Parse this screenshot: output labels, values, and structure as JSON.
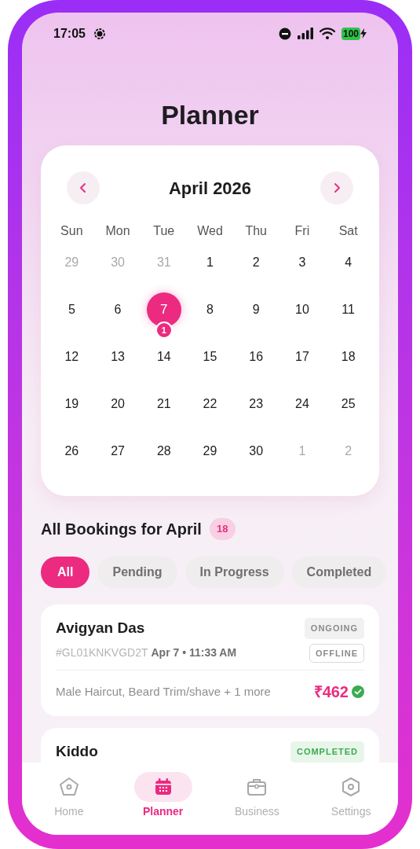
{
  "status_bar": {
    "time": "17:05",
    "battery": "100"
  },
  "title": "Planner",
  "calendar": {
    "month": "April 2026",
    "weekdays": [
      "Sun",
      "Mon",
      "Tue",
      "Wed",
      "Thu",
      "Fri",
      "Sat"
    ],
    "weeks": [
      [
        {
          "day": "29",
          "muted": true,
          "selected": false
        },
        {
          "day": "30",
          "muted": true,
          "selected": false
        },
        {
          "day": "31",
          "muted": true,
          "selected": false
        },
        {
          "day": "1",
          "muted": false,
          "selected": false
        },
        {
          "day": "2",
          "muted": false,
          "selected": false
        },
        {
          "day": "3",
          "muted": false,
          "selected": false
        },
        {
          "day": "4",
          "muted": false,
          "selected": false
        }
      ],
      [
        {
          "day": "5",
          "muted": false,
          "selected": false
        },
        {
          "day": "6",
          "muted": false,
          "selected": false
        },
        {
          "day": "7",
          "muted": false,
          "selected": true,
          "count": "1"
        },
        {
          "day": "8",
          "muted": false,
          "selected": false
        },
        {
          "day": "9",
          "muted": false,
          "selected": false
        },
        {
          "day": "10",
          "muted": false,
          "selected": false
        },
        {
          "day": "11",
          "muted": false,
          "selected": false
        }
      ],
      [
        {
          "day": "12",
          "muted": false,
          "selected": false
        },
        {
          "day": "13",
          "muted": false,
          "selected": false
        },
        {
          "day": "14",
          "muted": false,
          "selected": false
        },
        {
          "day": "15",
          "muted": false,
          "selected": false
        },
        {
          "day": "16",
          "muted": false,
          "selected": false
        },
        {
          "day": "17",
          "muted": false,
          "selected": false
        },
        {
          "day": "18",
          "muted": false,
          "selected": false
        }
      ],
      [
        {
          "day": "19",
          "muted": false,
          "selected": false
        },
        {
          "day": "20",
          "muted": false,
          "selected": false
        },
        {
          "day": "21",
          "muted": false,
          "selected": false
        },
        {
          "day": "22",
          "muted": false,
          "selected": false
        },
        {
          "day": "23",
          "muted": false,
          "selected": false
        },
        {
          "day": "24",
          "muted": false,
          "selected": false
        },
        {
          "day": "25",
          "muted": false,
          "selected": false
        }
      ],
      [
        {
          "day": "26",
          "muted": false,
          "selected": false
        },
        {
          "day": "27",
          "muted": false,
          "selected": false
        },
        {
          "day": "28",
          "muted": false,
          "selected": false
        },
        {
          "day": "29",
          "muted": false,
          "selected": false
        },
        {
          "day": "30",
          "muted": false,
          "selected": false
        },
        {
          "day": "1",
          "muted": true,
          "selected": false
        },
        {
          "day": "2",
          "muted": true,
          "selected": false
        }
      ]
    ]
  },
  "bookings": {
    "heading": "All Bookings for April",
    "count": "18",
    "filters": [
      {
        "label": "All",
        "selected": true
      },
      {
        "label": "Pending",
        "selected": false
      },
      {
        "label": "In Progress",
        "selected": false
      },
      {
        "label": "Completed",
        "selected": false
      }
    ],
    "items": [
      {
        "name": "Avigyan Das",
        "status": "ONGOING",
        "kind": "ongoing",
        "id": "#GL01KNKVGD2T",
        "when": "Apr 7 • 11:33 AM",
        "mode": "OFFLINE",
        "services": "Male Haircut, Beard Trim/shave + 1 more",
        "amount": "₹462",
        "paid": true
      },
      {
        "name": "Kiddo",
        "status": "COMPLETED",
        "kind": "completed"
      }
    ]
  },
  "nav": [
    {
      "label": "Home",
      "kind": "home",
      "selected": false
    },
    {
      "label": "Planner",
      "kind": "planner",
      "selected": true
    },
    {
      "label": "Business",
      "kind": "business",
      "selected": false
    },
    {
      "label": "Settings",
      "kind": "settings",
      "selected": false
    }
  ]
}
